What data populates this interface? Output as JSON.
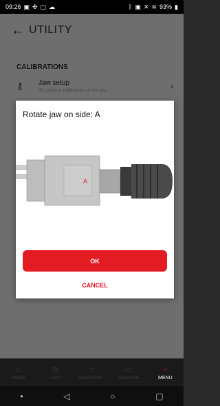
{
  "status": {
    "time": "09:26",
    "left_icons": [
      "sim-icon",
      "app-icon",
      "sd-icon",
      "cloud-icon"
    ],
    "right_icons": [
      "bluetooth-icon",
      "nfc-icon",
      "mute-icon",
      "wifi-icon",
      "signal-icon"
    ],
    "battery": "93%"
  },
  "appbar": {
    "title": "UTILITY"
  },
  "content": {
    "section_title": "CALIBRATIONS",
    "row": {
      "title": "Jaw setup",
      "subtitle": "To perform calibration of the jaw"
    }
  },
  "dialog": {
    "message": "Rotate jaw on side: A",
    "image_label": "A",
    "ok": "OK",
    "cancel": "CANCEL"
  },
  "nav": [
    {
      "label": "HOME",
      "icon": "home-icon"
    },
    {
      "label": "LAST",
      "icon": "clock-icon"
    },
    {
      "label": "BOOKMAR...",
      "icon": "star-icon"
    },
    {
      "label": "ARCHIVE",
      "icon": "folder-icon"
    },
    {
      "label": "MENU",
      "icon": "menu-icon"
    }
  ],
  "colors": {
    "accent": "#e31b23",
    "overlay": "#6e6e6e"
  }
}
